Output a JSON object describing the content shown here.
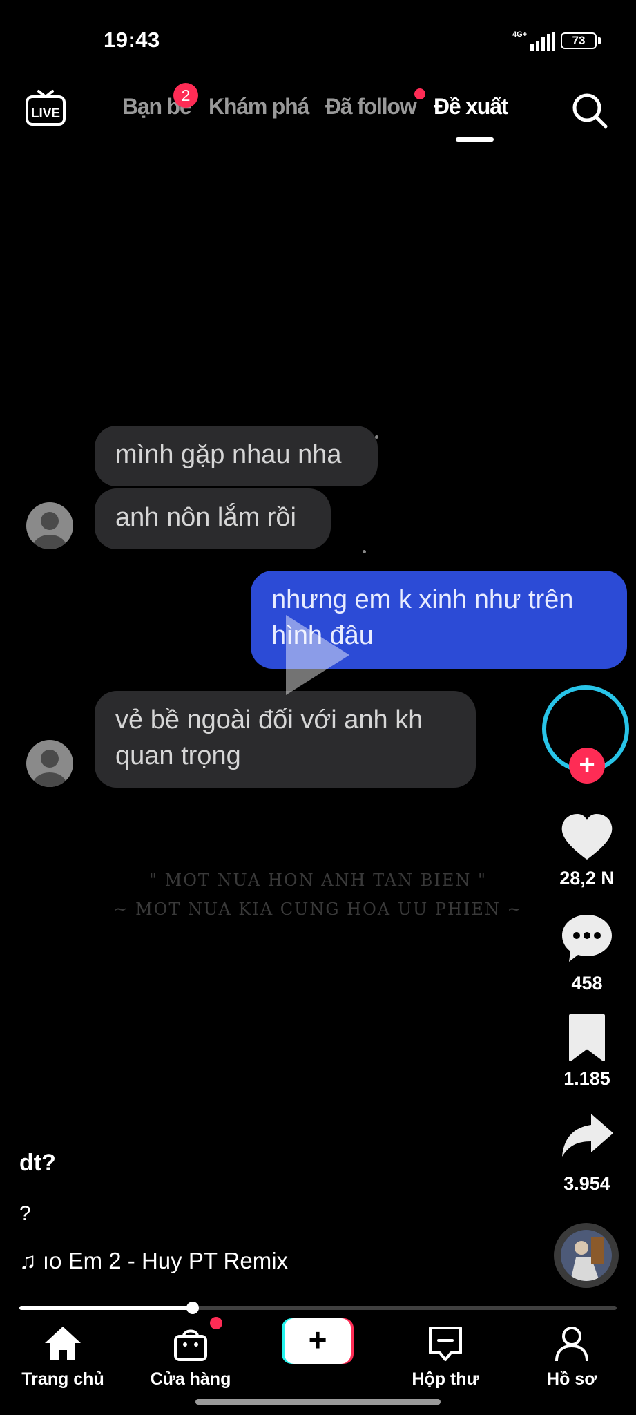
{
  "status_bar": {
    "time": "19:43",
    "network": "4G+",
    "battery": "73"
  },
  "top_nav": {
    "live_label": "LIVE",
    "tabs": [
      {
        "label": "Bạn bè",
        "badge": "2"
      },
      {
        "label": "Khám phá"
      },
      {
        "label": "Đã follow",
        "dot": true
      },
      {
        "label": "Đề xuất",
        "active": true
      }
    ]
  },
  "chat": {
    "messages": [
      {
        "side": "in",
        "text": "mình gặp nhau nha"
      },
      {
        "side": "in",
        "text": "anh nôn lắm rồi"
      },
      {
        "side": "out",
        "text": "nhưng em k xinh như trên\nhình đâu"
      },
      {
        "side": "in",
        "text": "vẻ bề ngoài đối với anh kh\nquan trọng"
      }
    ],
    "lyrics": [
      "\" MOT NUA HON ANH TAN BIEN \"",
      "~ MOT NUA KIA CUNG HOA UU PHIEN ~"
    ]
  },
  "actions": {
    "likes": "28,2 N",
    "comments": "458",
    "saves": "1.185",
    "shares": "3.954",
    "follow_plus": "+"
  },
  "caption": {
    "author": "dt?",
    "description": "?",
    "music_note": "♫",
    "music": "ıo Em 2 - Huy PT Remix"
  },
  "progress": {
    "fraction": 0.29
  },
  "bottom_nav": {
    "home": "Trang chủ",
    "shop": "Cửa hàng",
    "create": "+",
    "inbox": "Hộp thư",
    "profile": "Hồ sơ"
  },
  "colors": {
    "accent": "#fe2c55",
    "ring": "#28c4e8",
    "outgoing_bubble": "#2c4bd6",
    "incoming_bubble": "#2b2b2d"
  }
}
